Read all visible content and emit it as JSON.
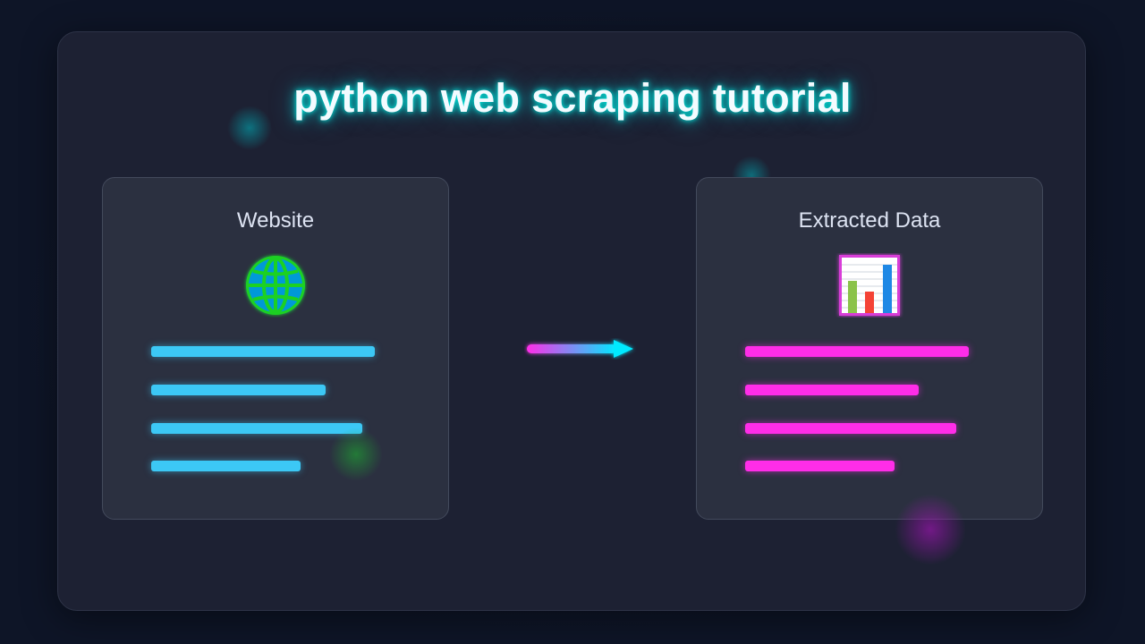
{
  "title": "python web scraping tutorial",
  "source": {
    "title": "Website",
    "icon": "globe-icon",
    "line_fractions": [
      1.0,
      0.78,
      0.944,
      0.668
    ],
    "color": "#3cc8f5"
  },
  "target": {
    "title": "Extracted Data",
    "icon": "bar-chart-icon",
    "line_fractions": [
      1.0,
      0.776,
      0.944,
      0.668
    ],
    "color": "#ff2de8"
  },
  "connector": {
    "icon": "arrow-right-icon",
    "gradient": [
      "#ff2de8",
      "#00eaff"
    ]
  }
}
